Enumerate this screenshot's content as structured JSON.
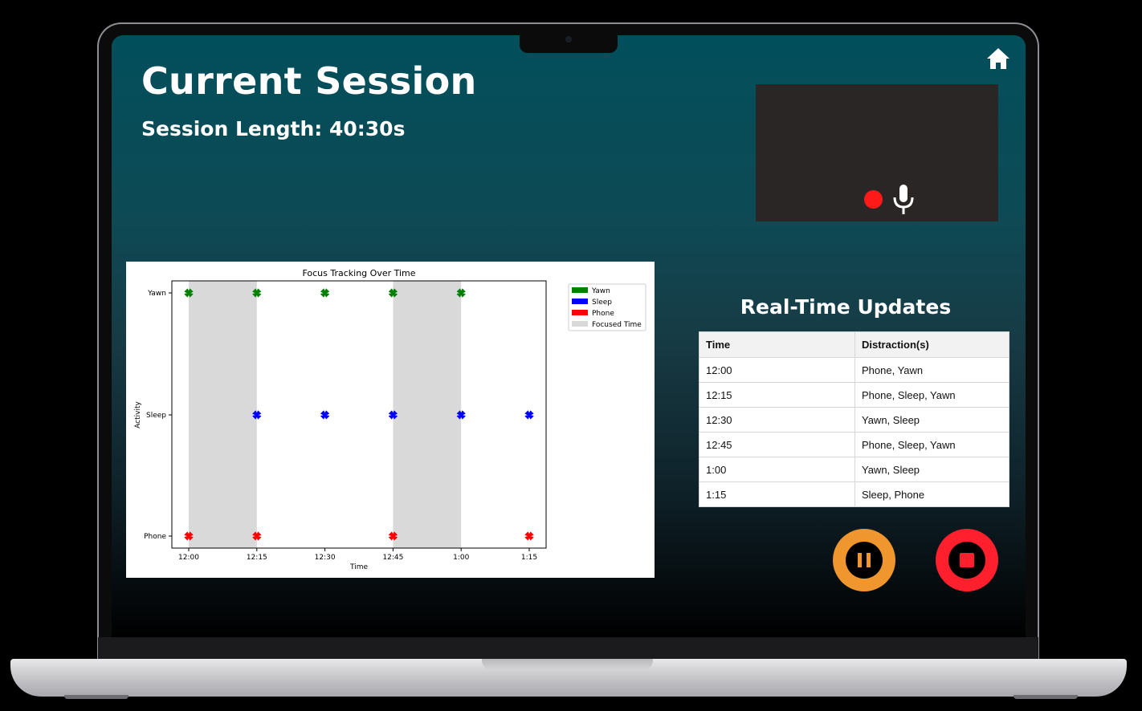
{
  "page": {
    "title": "Current Session",
    "session_length": "Session Length: 40:30s"
  },
  "icons": {
    "home": "home-icon",
    "record": "record-dot-icon",
    "mic": "microphone-icon",
    "pause": "pause-icon",
    "stop": "stop-icon"
  },
  "colors": {
    "yawn": "#008000",
    "sleep": "#0000ff",
    "phone": "#ff0000",
    "focused": "#d9d9d9",
    "record": "#ff1a1a",
    "pause_button": "#f0962e",
    "stop_button": "#ff1f2d"
  },
  "chart_data": {
    "type": "scatter",
    "title": "Focus Tracking Over Time",
    "xlabel": "Time",
    "ylabel": "Activity",
    "x_ticks": [
      "12:00",
      "12:15",
      "12:30",
      "12:45",
      "1:00",
      "1:15"
    ],
    "y_categories": [
      "Phone",
      "Sleep",
      "Yawn"
    ],
    "series": [
      {
        "name": "Yawn",
        "color": "#008000",
        "x": [
          "12:00",
          "12:15",
          "12:30",
          "12:45",
          "1:00"
        ],
        "y": "Yawn"
      },
      {
        "name": "Sleep",
        "color": "#0000ff",
        "x": [
          "12:15",
          "12:30",
          "12:45",
          "1:00",
          "1:15"
        ],
        "y": "Sleep"
      },
      {
        "name": "Phone",
        "color": "#ff0000",
        "x": [
          "12:00",
          "12:15",
          "12:45",
          "1:15"
        ],
        "y": "Phone"
      }
    ],
    "focused_time": {
      "name": "Focused Time",
      "color": "#d9d9d9",
      "intervals": [
        [
          "12:00",
          "12:15"
        ],
        [
          "12:45",
          "1:00"
        ]
      ]
    },
    "legend": [
      "Yawn",
      "Sleep",
      "Phone",
      "Focused Time"
    ],
    "legend_position": "outside right, top",
    "grid": false
  },
  "updates": {
    "title": "Real-Time Updates",
    "columns": [
      "Time",
      "Distraction(s)"
    ],
    "rows": [
      [
        "12:00",
        "Phone, Yawn"
      ],
      [
        "12:15",
        "Phone, Sleep, Yawn"
      ],
      [
        "12:30",
        "Yawn, Sleep"
      ],
      [
        "12:45",
        "Phone, Sleep, Yawn"
      ],
      [
        "1:00",
        "Yawn, Sleep"
      ],
      [
        "1:15",
        "Sleep, Phone"
      ]
    ]
  }
}
